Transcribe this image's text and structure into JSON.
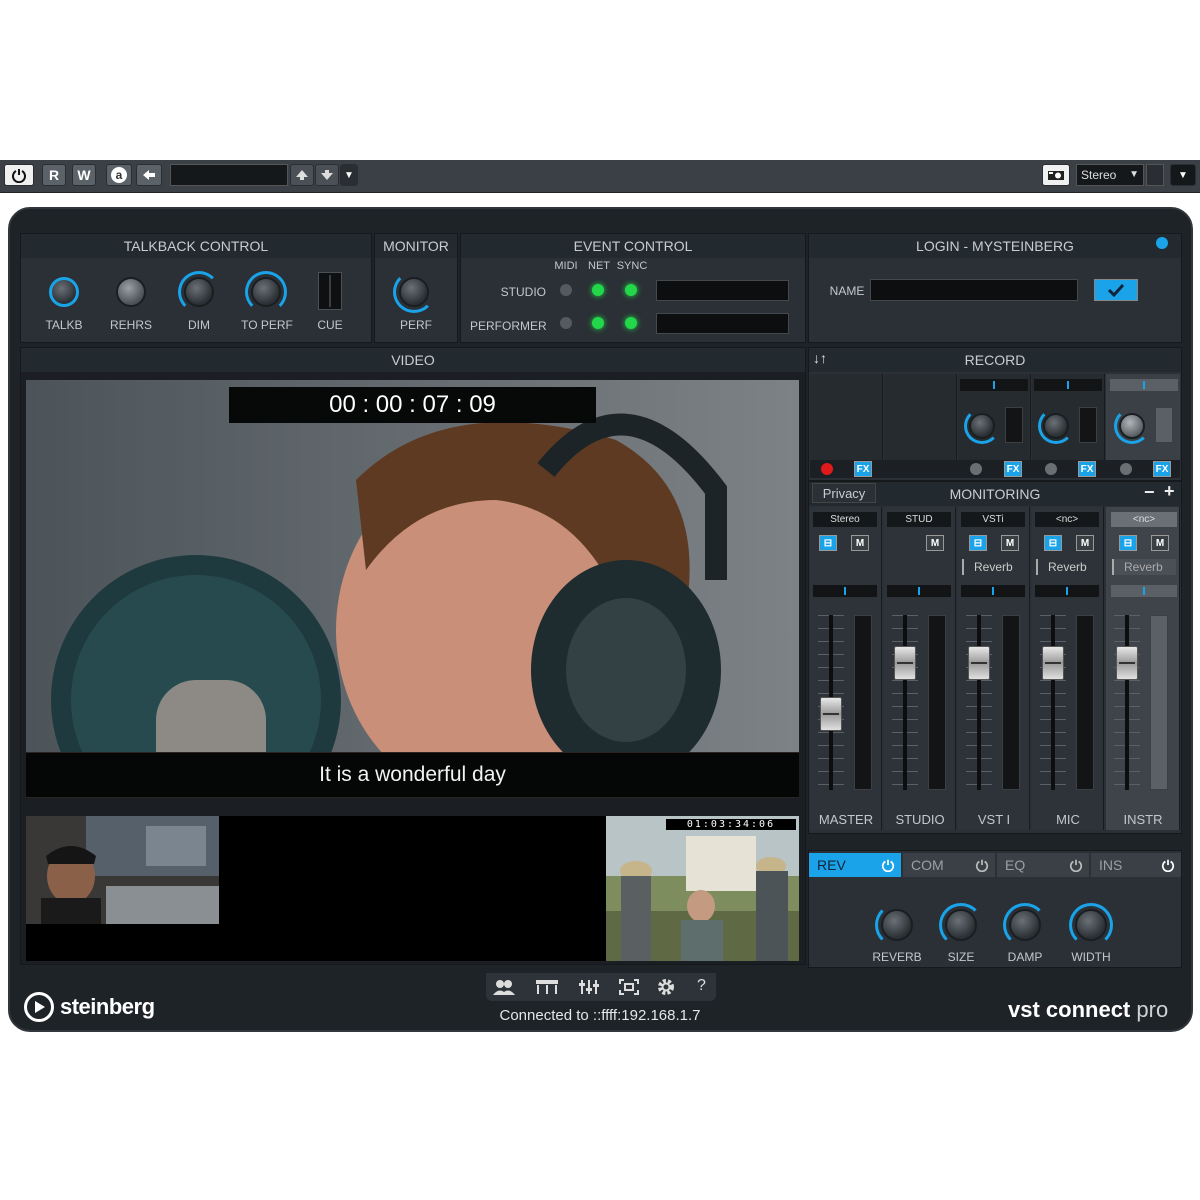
{
  "toolbar": {
    "r_label": "R",
    "w_label": "W",
    "a_label": "a",
    "output": "Stereo"
  },
  "talkback": {
    "title": "TALKBACK CONTROL",
    "knobs": [
      "TALKB",
      "REHRS",
      "DIM",
      "TO PERF",
      "CUE"
    ]
  },
  "monitor": {
    "title": "MONITOR",
    "knob": "PERF"
  },
  "event": {
    "title": "EVENT CONTROL",
    "cols": [
      "MIDI",
      "NET",
      "SYNC"
    ],
    "rows": [
      "STUDIO",
      "PERFORMER"
    ]
  },
  "login": {
    "title": "LOGIN - MYSTEINBERG",
    "name_label": "NAME",
    "name_value": ""
  },
  "video": {
    "title": "VIDEO",
    "timecode": "00 : 00 : 07 : 09",
    "subtitle": "It is a wonderful day",
    "pip_timecode": "01:03:34:06"
  },
  "record": {
    "title": "RECORD",
    "sort_icon": "↓↑",
    "fx": "FX"
  },
  "monitoring": {
    "title": "MONITORING",
    "privacy": "Privacy",
    "minus": "−",
    "plus": "+",
    "channels": [
      {
        "route": "Stereo",
        "name": "MASTER",
        "insert": "",
        "fader": 0.42
      },
      {
        "route": "STUD",
        "name": "STUDIO",
        "insert": "",
        "fader": 0.78
      },
      {
        "route": "VSTi",
        "name": "VST I",
        "insert": "Reverb",
        "fader": 0.78
      },
      {
        "route": "<nc>",
        "name": "MIC",
        "insert": "Reverb",
        "fader": 0.78
      },
      {
        "route": "<nc>",
        "name": "INSTR",
        "insert": "Reverb",
        "fader": 0.78
      }
    ]
  },
  "effects": {
    "tabs": [
      "REV",
      "COM",
      "EQ",
      "INS"
    ],
    "knobs": [
      "REVERB",
      "SIZE",
      "DAMP",
      "WIDTH"
    ]
  },
  "footer": {
    "brand": "steinberg",
    "status": "Connected to ::ffff:192.168.1.7",
    "product_bold": "vst connect",
    "product_light": "pro",
    "help": "?"
  },
  "colors": {
    "accent": "#1aa3e8",
    "led_green": "#22d84a",
    "led_red": "#e01a1a",
    "bg": "#1e2328"
  }
}
